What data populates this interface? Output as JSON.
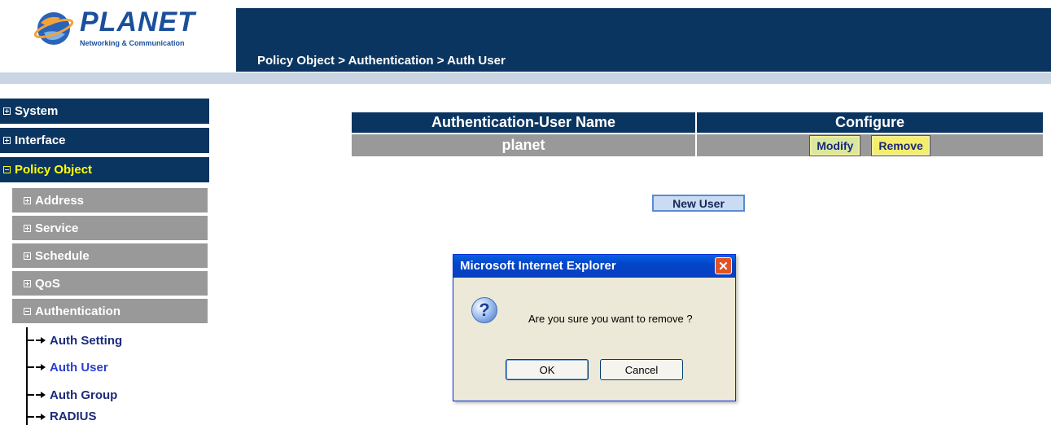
{
  "header": {
    "logo_text": "PLANET",
    "logo_subtext": "Networking & Communication",
    "breadcrumb": "Policy Object > Authentication > Auth User"
  },
  "sidebar": {
    "main_items": [
      {
        "label": "System",
        "expanded": false
      },
      {
        "label": "Interface",
        "expanded": false
      },
      {
        "label": "Policy Object",
        "expanded": true
      }
    ],
    "sub_items": [
      {
        "label": "Address",
        "expanded": false
      },
      {
        "label": "Service",
        "expanded": false
      },
      {
        "label": "Schedule",
        "expanded": false
      },
      {
        "label": "QoS",
        "expanded": false
      },
      {
        "label": "Authentication",
        "expanded": true
      }
    ],
    "tree_items": [
      {
        "label": "Auth Setting",
        "current": false
      },
      {
        "label": "Auth User",
        "current": true
      },
      {
        "label": "Auth Group",
        "current": false
      },
      {
        "label": "RADIUS",
        "current": false
      }
    ]
  },
  "table": {
    "headers": [
      "Authentication-User Name",
      "Configure"
    ],
    "rows": [
      {
        "name": "planet",
        "modify_label": "Modify",
        "remove_label": "Remove"
      }
    ]
  },
  "new_user_button": "New User",
  "dialog": {
    "title": "Microsoft Internet Explorer",
    "close_glyph": "✕",
    "icon_glyph": "?",
    "message": "Are you sure you want to remove ?",
    "ok_label": "OK",
    "cancel_label": "Cancel"
  },
  "colors": {
    "navy": "#0b3561",
    "gray": "#999999",
    "active_menu": "#ffff00",
    "link": "#2a3fd0"
  }
}
